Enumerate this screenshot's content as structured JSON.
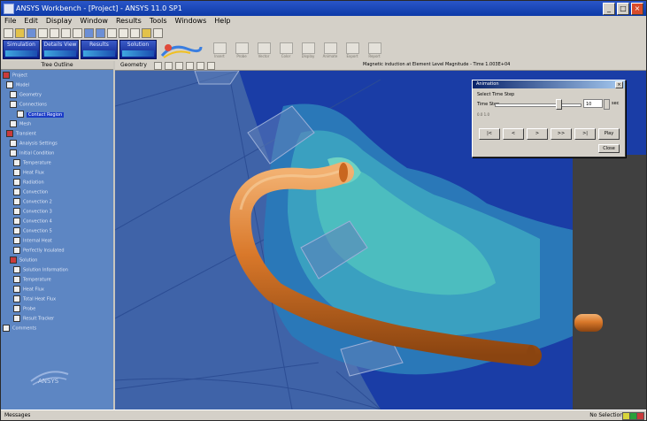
{
  "window": {
    "title": "ANSYS Workbench - [Project] - ANSYS 11.0 SP1",
    "controls": [
      "_",
      "□",
      "×"
    ]
  },
  "menu": [
    "File",
    "Edit",
    "Display",
    "Window",
    "Results",
    "Tools",
    "Windows",
    "Help"
  ],
  "ribbon": {
    "tabs": [
      "Simulation",
      "Details View",
      "Results",
      "Solution"
    ],
    "tools": [
      "Insert",
      "Probe",
      "Vector",
      "Color",
      "Display",
      "Animate",
      "Export",
      "Report"
    ]
  },
  "tree": {
    "header": "Tree Outline",
    "items": [
      "Project",
      "Model",
      "Geometry",
      "Connections",
      "Contact Region",
      "Mesh",
      "Transient",
      "Analysis Settings",
      "Initial Condition",
      "Temperature",
      "Heat Flux",
      "Radiation",
      "Convection",
      "Convection 2",
      "Convection 3",
      "Convection 4",
      "Convection 5",
      "Internal Heat",
      "Perfectly Insulated",
      "Solution",
      "Solution Information",
      "Temperature",
      "Heat Flux",
      "Total Heat Flux",
      "Probe",
      "Result Tracker",
      "Comments"
    ],
    "selected_index": 4,
    "watermark": "ANSYS"
  },
  "viewer": {
    "label": "Geometry",
    "title": "Magnetic induction at Element Level Magnitude - Time 1.003E+04"
  },
  "dialog": {
    "title": "Animation",
    "group": "Select Time Step",
    "label": "Time Step",
    "value": "10",
    "unit": "sec",
    "range": "0.0    1.0",
    "buttons": [
      "|<",
      "<",
      ">",
      ">>",
      ">|",
      "Play"
    ],
    "close": "Close"
  },
  "status": {
    "left": "Messages",
    "right": "No Selection",
    "indicators": [
      "#d8d53a",
      "#2aa03a",
      "#c83a3a"
    ]
  }
}
